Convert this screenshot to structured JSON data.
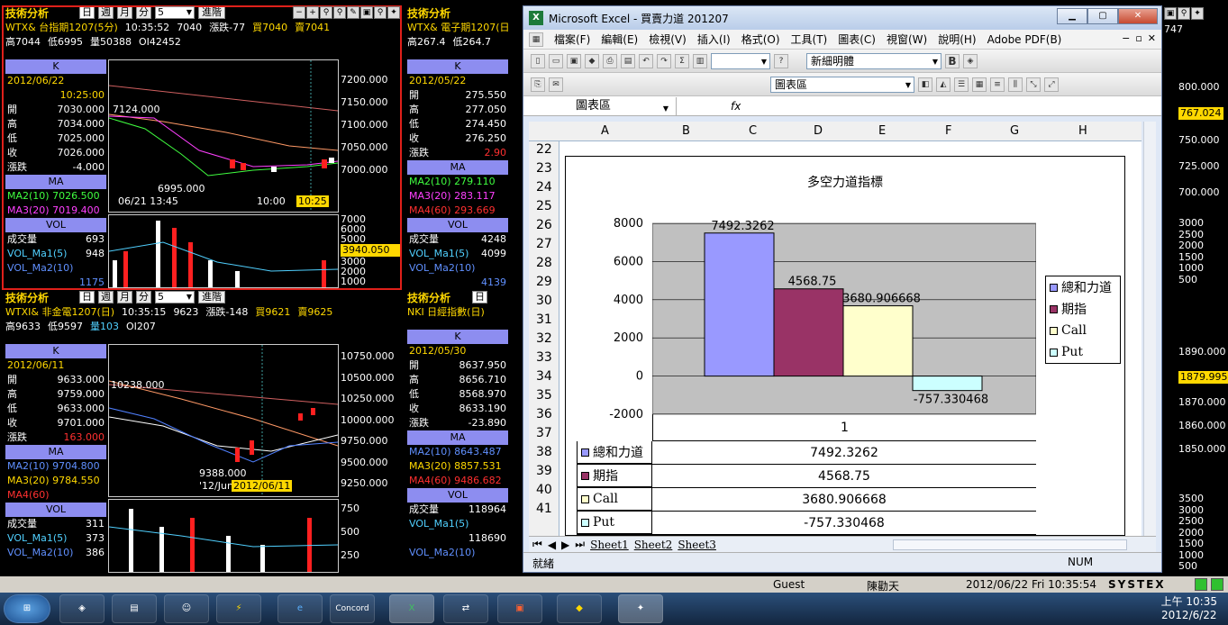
{
  "panels": {
    "p1": {
      "title": "技術分析",
      "btn_day": "日",
      "btn_week": "週",
      "btn_month": "月",
      "btn_min": "分",
      "period": "5",
      "advanced": "進階",
      "symbol": "WTX&  台指期1207(5分)",
      "time": "10:35:52",
      "price": "7040",
      "change": "漲跌-77",
      "buy": "買7040",
      "sell": "賣7041",
      "high": "高7044",
      "low": "低6995",
      "vol": "量50388",
      "oi": "OI42452",
      "k_label": "K",
      "date": "2012/06/22",
      "clock": "10:25:00",
      "open_k": "開",
      "open": "7030.000",
      "high_k": "高",
      "highv": "7034.000",
      "low_k": "低",
      "lowv": "7025.000",
      "close_k": "收",
      "close": "7026.000",
      "chg_k": "漲跌",
      "chg": "-4.000",
      "ma_label": "MA",
      "ma2": "MA2(10) 7026.500",
      "ma3": "MA3(20) 7019.400",
      "vol_label": "VOL",
      "vol_k": "成交量",
      "vol_v": "693",
      "vma1_k": "VOL_Ma1(5)",
      "vma1_v": "948",
      "vma2_k": "VOL_Ma2(10)",
      "vma2_v": "1175",
      "ax": [
        "7200.000",
        "7150.000",
        "7100.000",
        "7050.000",
        "7000.000"
      ],
      "vol_ax": [
        "7000",
        "6000",
        "5000",
        "4000",
        "3000",
        "2000",
        "1000"
      ],
      "vol_tag": "3940.050",
      "hi_mark": "7124.000",
      "lo_mark": "6995.000",
      "t1": "06/21 13:45",
      "t2": "10:00",
      "t3": "10:25"
    },
    "p2": {
      "title": "技術分析",
      "symbol": "WTX&  電子期1207(日",
      "high": "高267.4",
      "low": "低264.7",
      "k_label": "K",
      "date": "2012/05/22",
      "open_k": "開",
      "open": "275.550",
      "high_k": "高",
      "highv": "277.050",
      "low_k": "低",
      "lowv": "274.450",
      "close_k": "收",
      "close": "276.250",
      "chg_k": "漲跌",
      "chg": "2.90",
      "ma_label": "MA",
      "ma2": "MA2(10)  279.110",
      "ma3": "MA3(20)  283.117",
      "ma4": "MA4(60)  293.669",
      "vol_label": "VOL",
      "vol_k": "成交量",
      "vol_v": "4248",
      "vma1_k": "VOL_Ma1(5)",
      "vma1_v": "4099",
      "vma2_k": "VOL_Ma2(10)",
      "vma2_v": "4139"
    },
    "p3": {
      "title": "技術分析",
      "btn_day": "日",
      "btn_week": "週",
      "btn_month": "月",
      "btn_min": "分",
      "period": "5",
      "advanced": "進階",
      "symbol": "WTXI&  非金電1207(日)",
      "time": "10:35:15",
      "price": "9623",
      "change": "漲跌-148",
      "buy": "買9621",
      "sell": "賣9625",
      "high": "高9633",
      "low": "低9597",
      "vol": "量103",
      "oi": "OI207",
      "k_label": "K",
      "date": "2012/06/11",
      "open_k": "開",
      "open": "9633.000",
      "high_k": "高",
      "highv": "9759.000",
      "low_k": "低",
      "lowv": "9633.000",
      "close_k": "收",
      "close": "9701.000",
      "chg_k": "漲跌",
      "chg": "163.000",
      "ma_label": "MA",
      "ma2": "MA2(10) 9704.800",
      "ma3": "MA3(20) 9784.550",
      "ma4": "MA4(60)",
      "vol_label": "VOL",
      "vol_k": "成交量",
      "vol_v": "311",
      "vma1_k": "VOL_Ma1(5)",
      "vma1_v": "373",
      "vma2_k": "VOL_Ma2(10)",
      "vma2_v": "386",
      "ax": [
        "10750.000",
        "10500.000",
        "10250.000",
        "10000.000",
        "9750.000",
        "9500.000",
        "9250.000"
      ],
      "vol_ax": [
        "750",
        "500",
        "250"
      ],
      "hi_mark": "10238.000",
      "lo_mark": "9388.000",
      "t1": "'12/Jun",
      "t2": "2012/06/11"
    },
    "p4": {
      "title": "技術分析",
      "btn_day": "日",
      "symbol": "NKI  日經指數(日)",
      "k_label": "K",
      "date": "2012/05/30",
      "open_k": "開",
      "open": "8637.950",
      "high_k": "高",
      "highv": "8656.710",
      "low_k": "低",
      "lowv": "8568.970",
      "close_k": "收",
      "close": "8633.190",
      "chg_k": "漲跌",
      "chg": "-23.890",
      "ma_label": "MA",
      "ma2": "MA2(10) 8643.487",
      "ma3": "MA3(20) 8857.531",
      "ma4": "MA4(60) 9486.682",
      "vol_label": "VOL",
      "vol_k": "成交量",
      "vol_v": "118964",
      "vma1_k": "VOL_Ma1(5)",
      "vma1_v": "118690",
      "vma2_k": "VOL_Ma2(10)"
    },
    "right": {
      "ax1": [
        "800.000",
        "767.024",
        "750.000",
        "725.000",
        "700.000"
      ],
      "top": "747",
      "vol": [
        "3000",
        "2500",
        "2000",
        "1500",
        "1000",
        "500"
      ],
      "ax2": [
        "1890.000",
        "1879.995",
        "1870.000",
        "1860.000",
        "1850.000"
      ],
      "vol2": [
        "3500",
        "3000",
        "2500",
        "2000",
        "1500",
        "1000",
        "500"
      ]
    }
  },
  "excel": {
    "title": "Microsoft Excel - 買賣力道 201207",
    "menu": [
      "檔案(F)",
      "編輯(E)",
      "檢視(V)",
      "插入(I)",
      "格式(O)",
      "工具(T)",
      "圖表(C)",
      "視窗(W)",
      "說明(H)",
      "Adobe PDF(B)"
    ],
    "font_combo": "新細明體",
    "bold": "B",
    "chart_area_combo": "圖表區",
    "namebox": "圖表區",
    "fx": "fx",
    "columns": [
      "A",
      "B",
      "C",
      "D",
      "E",
      "F",
      "G",
      "H"
    ],
    "rows": [
      "22",
      "23",
      "24",
      "25",
      "26",
      "27",
      "28",
      "29",
      "30",
      "31",
      "32",
      "33",
      "34",
      "35",
      "36",
      "37",
      "38",
      "39",
      "40",
      "41"
    ],
    "sheets": [
      "Sheet1",
      "Sheet2",
      "Sheet3"
    ],
    "status": "就緒",
    "num": "NUM"
  },
  "chart_data": {
    "type": "bar",
    "title": "多空力道指標",
    "categories": [
      "1"
    ],
    "series": [
      {
        "name": "總和力道",
        "values": [
          7492.3262
        ],
        "color": "#9999ff"
      },
      {
        "name": "期指",
        "values": [
          4568.75
        ],
        "color": "#993366"
      },
      {
        "name": "Call",
        "values": [
          3680.906668
        ],
        "color": "#ffffcc"
      },
      {
        "name": "Put",
        "values": [
          -757.330468
        ],
        "color": "#ccffff"
      }
    ],
    "data_labels": [
      "7492.3262",
      "4568.75",
      "3680.906668",
      "-757.330468"
    ],
    "yticks": [
      "8000",
      "6000",
      "4000",
      "2000",
      "0",
      "-2000"
    ],
    "ylim": [
      -2000,
      8000
    ],
    "legend": "right",
    "table_values": [
      "7492.3262",
      "4568.75",
      "3680.906668",
      "-757.330468"
    ]
  },
  "status_strip": {
    "user": "Guest",
    "name": "陳勸天",
    "datetime": "2012/06/22 Fri 10:35:54",
    "brand": "SYSTEX"
  },
  "taskbar": {
    "time": "上午 10:35",
    "date": "2012/6/22",
    "concord": "Concord"
  }
}
